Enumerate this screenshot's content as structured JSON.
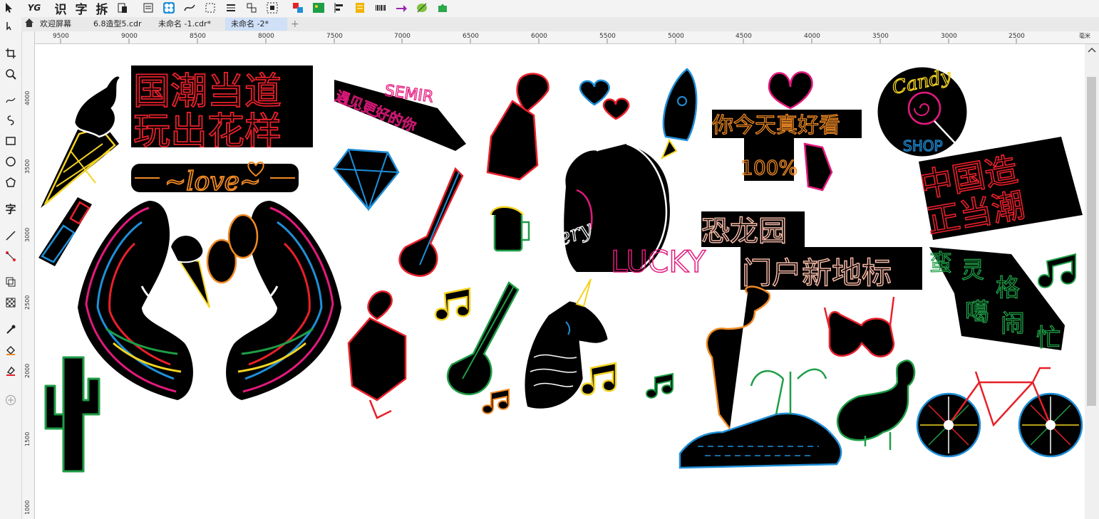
{
  "toolbar": {
    "yg_label": "YG",
    "shi_label": "识",
    "zi_label": "字",
    "chai_label": "拆"
  },
  "tabs": [
    {
      "label": "欢迎屏幕"
    },
    {
      "label": "6.8造型5.cdr"
    },
    {
      "label": "未命名 -1.cdr*"
    },
    {
      "label": "未命名 -2*"
    }
  ],
  "toolbox": {
    "zi_tool_label": "字"
  },
  "hruler_ticks": [
    "9500",
    "9000",
    "8500",
    "8000",
    "7500",
    "7000",
    "6500",
    "6000",
    "5500",
    "5000",
    "4500",
    "4000",
    "3500",
    "3000",
    "2500"
  ],
  "hruler_unit": "毫米",
  "vruler_ticks": [
    "4000",
    "3500",
    "3000",
    "2500",
    "2000",
    "1500",
    "1000"
  ],
  "artwork": {
    "guochao_line1": "国潮当道",
    "guochao_line2": "玩出花样",
    "love": "~love~",
    "semir": "SEMIR",
    "semir_sub": "遇见更好的你",
    "lucky": "LUCKY",
    "very": "Very",
    "nijintian": "你今天真好看",
    "percent": "100%",
    "candy": "Candy",
    "shop": "SHOP",
    "zhongguo_line1": "中国造",
    "zhongguo_line2": "正当潮",
    "konglong": "恐龙园",
    "menhu": "门户新地标",
    "manling_1": "蛮",
    "manling_2": "灵",
    "manling_3": "格",
    "manling_4": "噶",
    "manling_5": "闹",
    "manling_6": "忙"
  },
  "colors": {
    "red": "#e8202a",
    "pink": "#e4197e",
    "orange": "#f08a24",
    "yellow": "#f3d321",
    "blue": "#1f8fd8",
    "green": "#1e9e46",
    "white": "#ffffff",
    "black": "#000000"
  }
}
